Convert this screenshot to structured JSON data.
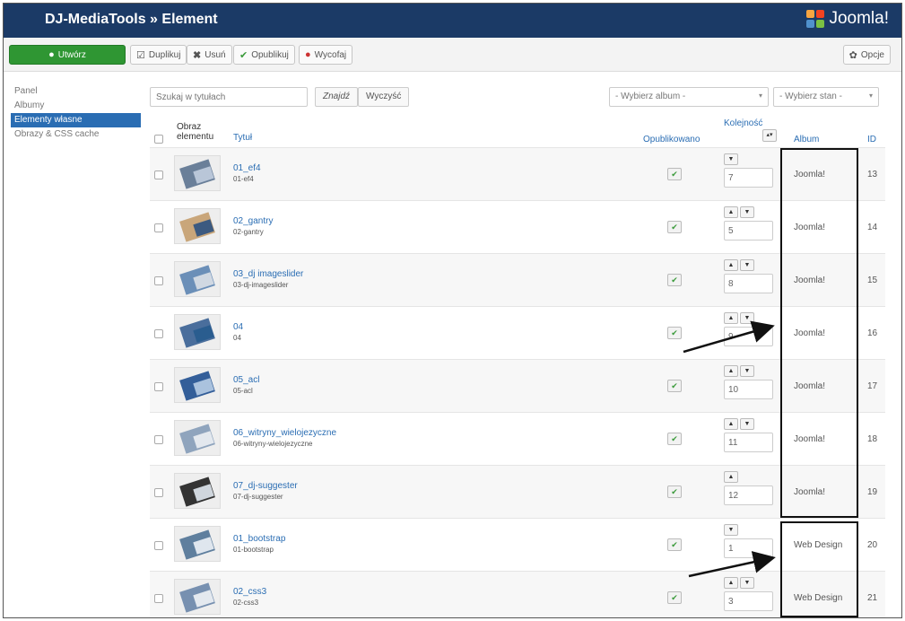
{
  "header": {
    "title": "DJ-MediaTools » Element",
    "logo_text": "Joomla!"
  },
  "toolbar": {
    "new_label": "Utwórz",
    "copy_label": "Duplikuj",
    "delete_label": "Usuń",
    "publish_label": "Opublikuj",
    "unpublish_label": "Wycofaj",
    "options_label": "Opcje"
  },
  "sidebar": {
    "items": [
      {
        "label": "Panel"
      },
      {
        "label": "Albumy"
      },
      {
        "label": "Elementy własne"
      },
      {
        "label": "Obrazy & CSS cache"
      }
    ]
  },
  "filters": {
    "search_placeholder": "Szukaj w tytułach",
    "find_label": "Znajdź",
    "clear_label": "Wyczyść",
    "album_select": "- Wybierz album -",
    "state_select": "- Wybierz stan -"
  },
  "table": {
    "headers": {
      "image": "Obraz elementu",
      "title": "Tytuł",
      "published": "Opublikowano",
      "ordering": "Kolejność",
      "album": "Album",
      "id": "ID"
    },
    "rows": [
      {
        "title": "01_ef4",
        "alias": "01-ef4",
        "ordering": "7",
        "album": "Joomla!",
        "id": "13",
        "has_up": false
      },
      {
        "title": "02_gantry",
        "alias": "02-gantry",
        "ordering": "5",
        "album": "Joomla!",
        "id": "14",
        "has_up": true
      },
      {
        "title": "03_dj imageslider",
        "alias": "03-dj-imageslider",
        "ordering": "8",
        "album": "Joomla!",
        "id": "15",
        "has_up": true
      },
      {
        "title": "04",
        "alias": "04",
        "ordering": "9",
        "album": "Joomla!",
        "id": "16",
        "has_up": true
      },
      {
        "title": "05_acl",
        "alias": "05-acl",
        "ordering": "10",
        "album": "Joomla!",
        "id": "17",
        "has_up": true
      },
      {
        "title": "06_witryny_wielojezyczne",
        "alias": "06-witryny-wielojezyczne",
        "ordering": "11",
        "album": "Joomla!",
        "id": "18",
        "has_up": true
      },
      {
        "title": "07_dj-suggester",
        "alias": "07-dj-suggester",
        "ordering": "12",
        "album": "Joomla!",
        "id": "19",
        "has_up": true
      },
      {
        "title": "01_bootstrap",
        "alias": "01-bootstrap",
        "ordering": "1",
        "album": "Web Design",
        "id": "20",
        "has_up": false
      },
      {
        "title": "02_css3",
        "alias": "02-css3",
        "ordering": "3",
        "album": "Web Design",
        "id": "21",
        "has_up": true
      }
    ]
  },
  "colors": {
    "header_bg": "#1b3a66",
    "new_button": "#2f9633",
    "link": "#2a6db3",
    "annotation": "#111111"
  }
}
